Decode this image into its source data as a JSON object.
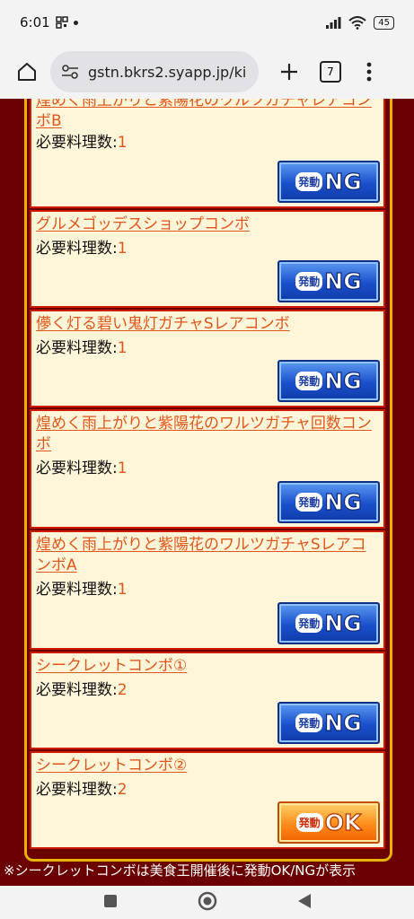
{
  "status": {
    "time": "6:01",
    "battery": "45"
  },
  "browser": {
    "url": "gstn.bkrs2.syapp.jp/ki",
    "tab_count": "7"
  },
  "combos": [
    {
      "title": "煌めく雨上がりと紫陽花のワルツガチャレアコンボB",
      "req_label": "必要料理数:",
      "req_value": "1",
      "status": "NG"
    },
    {
      "title": "グルメゴッデスショップコンボ",
      "req_label": "必要料理数:",
      "req_value": "1",
      "status": "NG"
    },
    {
      "title": "儚く灯る碧い鬼灯ガチャSレアコンボ",
      "req_label": "必要料理数:",
      "req_value": "1",
      "status": "NG"
    },
    {
      "title": "煌めく雨上がりと紫陽花のワルツガチャ回数コンボ",
      "req_label": "必要料理数:",
      "req_value": "1",
      "status": "NG"
    },
    {
      "title": "煌めく雨上がりと紫陽花のワルツガチャSレアコンボA",
      "req_label": "必要料理数:",
      "req_value": "1",
      "status": "NG"
    },
    {
      "title": "シークレットコンボ①",
      "req_label": "必要料理数:",
      "req_value": "2",
      "status": "NG"
    },
    {
      "title": "シークレットコンボ②",
      "req_label": "必要料理数:",
      "req_value": "2",
      "status": "OK"
    }
  ],
  "badge": {
    "small_label": "発動",
    "ng_label": "NG",
    "ok_label": "OK"
  },
  "footnote": "※シークレットコンボは美食王開催後に発動OK/NGが表示",
  "colors": {
    "background": "#6b0000",
    "card": "#fff5d8",
    "card_border": "#d01a00",
    "link": "#e0561a",
    "frame": "#e6b400"
  }
}
